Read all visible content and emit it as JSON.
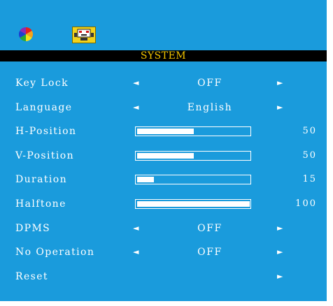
{
  "menu": {
    "title": "SYSTEM",
    "icons": [
      "color-wheel-icon",
      "system-icon"
    ],
    "accent_color": "#1a9bdc",
    "title_color": "#f0c300",
    "items": [
      {
        "label": "Key Lock",
        "type": "select",
        "value": "OFF"
      },
      {
        "label": "Language",
        "type": "select",
        "value": "English"
      },
      {
        "label": "H-Position",
        "type": "slider",
        "value": 50,
        "display": "50"
      },
      {
        "label": "V-Position",
        "type": "slider",
        "value": 50,
        "display": "50"
      },
      {
        "label": "Duration",
        "type": "slider",
        "value": 15,
        "display": "15"
      },
      {
        "label": "Halftone",
        "type": "slider",
        "value": 100,
        "display": "100"
      },
      {
        "label": "DPMS",
        "type": "select",
        "value": "OFF"
      },
      {
        "label": "No Operation",
        "type": "select",
        "value": "OFF"
      },
      {
        "label": "Reset",
        "type": "action"
      }
    ],
    "arrow_left": "◄",
    "arrow_right": "►"
  }
}
